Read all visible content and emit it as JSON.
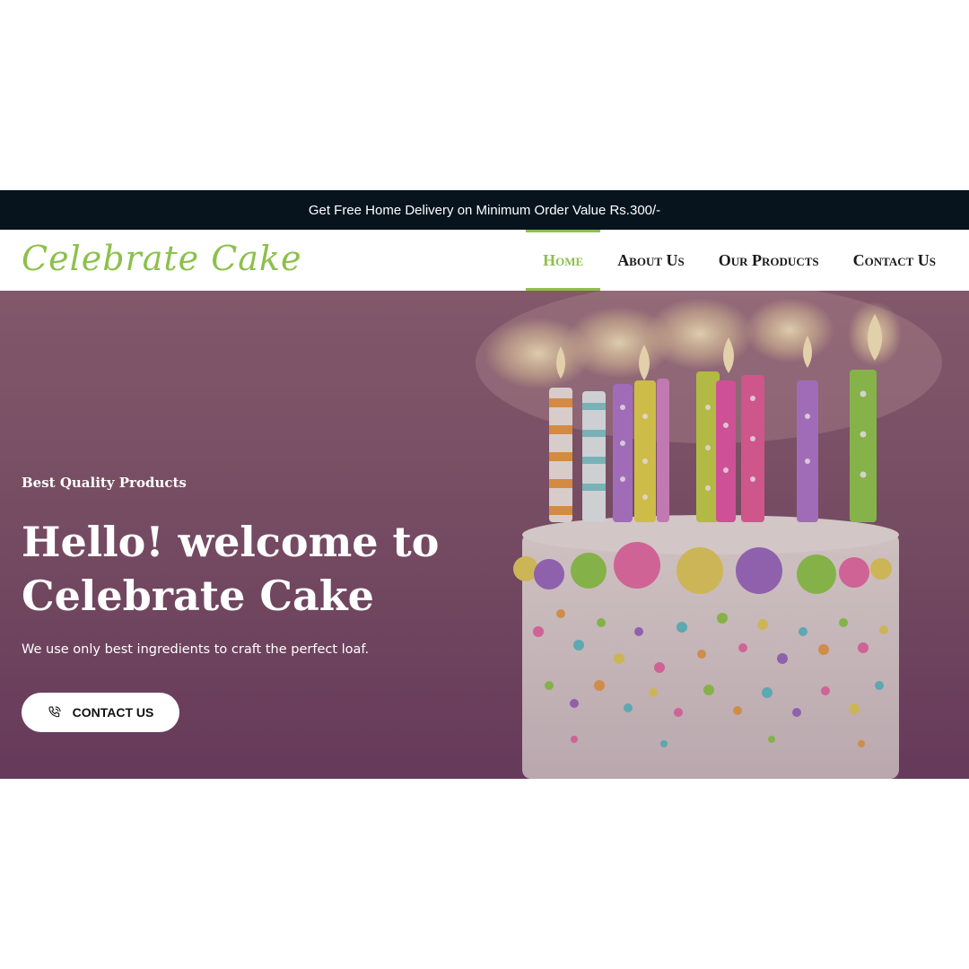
{
  "announcement": {
    "text": "Get Free Home Delivery on Minimum Order Value Rs.300/-"
  },
  "header": {
    "logo_text": "Celebrate Cake",
    "nav": [
      {
        "label": "Home",
        "active": true
      },
      {
        "label": "About Us",
        "active": false
      },
      {
        "label": "Our Products",
        "active": false
      },
      {
        "label": "Contact Us",
        "active": false
      }
    ]
  },
  "hero": {
    "eyebrow": "Best Quality Products",
    "title": "Hello! welcome to Celebrate Cake",
    "subtitle": "We use only best ingredients to craft the perfect loaf.",
    "cta": {
      "label": "CONTACT US",
      "icon": "phone-icon"
    },
    "image": "birthday-cake-with-candles"
  },
  "colors": {
    "accent": "#8cc04b",
    "topbar_bg": "#07141e",
    "hero_tint": "#7d5469"
  }
}
